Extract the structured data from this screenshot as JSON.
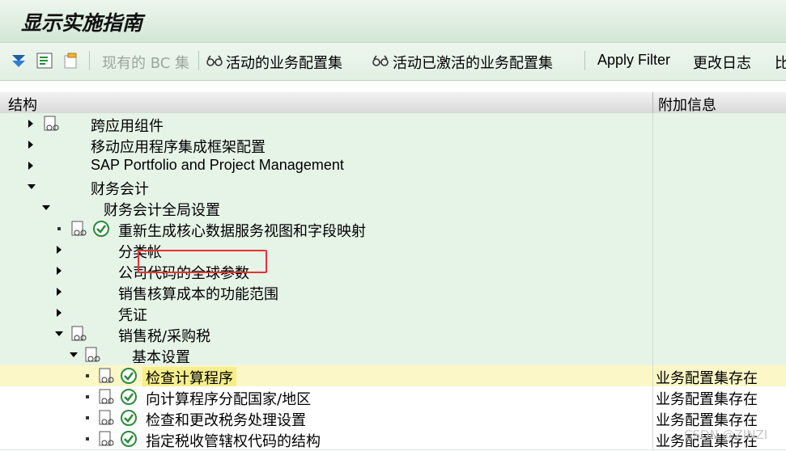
{
  "window": {
    "title": "显示实施指南"
  },
  "toolbar": {
    "current_bc_set": "现有的 BC 集",
    "active_bc_sets": "活动的业务配置集",
    "activated_bc_sets": "活动已激活的业务配置集",
    "apply_filter": "Apply Filter",
    "change_log": "更改日志",
    "more": "比"
  },
  "table": {
    "col_structure": "结构",
    "col_additional_info": "附加信息"
  },
  "tree": [
    {
      "label": "跨应用组件",
      "info": ""
    },
    {
      "label": "移动应用程序集成框架配置",
      "info": ""
    },
    {
      "label": "SAP Portfolio and Project Management",
      "info": ""
    },
    {
      "label": "财务会计",
      "info": ""
    },
    {
      "label": "财务会计全局设置",
      "info": ""
    },
    {
      "label": "重新生成核心数据服务视图和字段映射",
      "info": ""
    },
    {
      "label": "分类帐",
      "info": ""
    },
    {
      "label": "公司代码的全球参数",
      "info": ""
    },
    {
      "label": "销售核算成本的功能范围",
      "info": ""
    },
    {
      "label": "凭证",
      "info": ""
    },
    {
      "label": "销售税/采购税",
      "info": ""
    },
    {
      "label": "基本设置",
      "info": ""
    },
    {
      "label": "检查计算程序",
      "info": "业务配置集存在"
    },
    {
      "label": "向计算程序分配国家/地区",
      "info": "业务配置集存在"
    },
    {
      "label": "检查和更改税务处理设置",
      "info": "业务配置集存在"
    },
    {
      "label": "指定税收管辖权代码的结构",
      "info": "业务配置集存在"
    }
  ],
  "watermark": "CSDN @ZINZI",
  "colors": {
    "tree_bg": "#e6f3e7",
    "selected_bg": "#fbf7c6",
    "highlight_box": "#e53333"
  }
}
